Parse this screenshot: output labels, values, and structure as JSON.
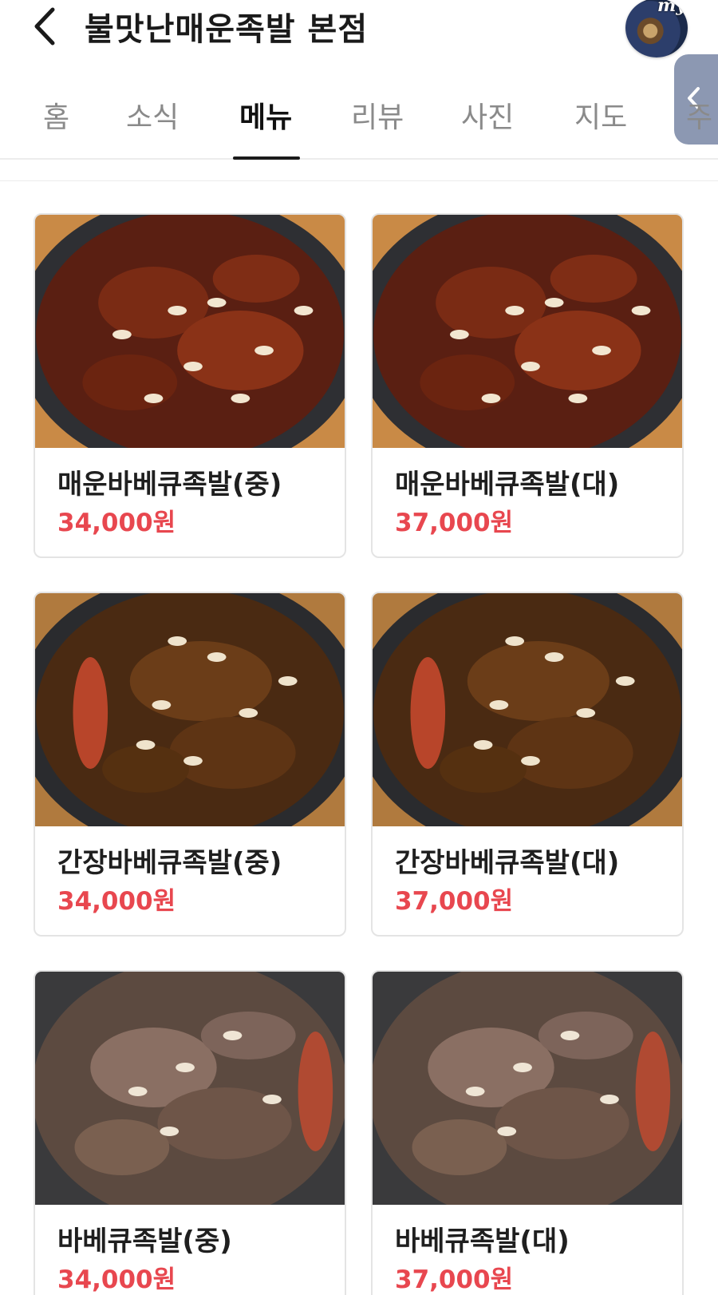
{
  "header": {
    "title": "불맛난매운족발 본점",
    "avatar_badge": "my"
  },
  "tabs": [
    {
      "label": "홈"
    },
    {
      "label": "소식"
    },
    {
      "label": "메뉴"
    },
    {
      "label": "리뷰"
    },
    {
      "label": "사진"
    },
    {
      "label": "지도"
    },
    {
      "label": "주"
    }
  ],
  "active_tab": "메뉴",
  "menu": [
    {
      "name": "매운바베큐족발(중)",
      "price": "34,000원",
      "photo": "spicy-bbq-jokbal"
    },
    {
      "name": "매운바베큐족발(대)",
      "price": "37,000원",
      "photo": "spicy-bbq-jokbal"
    },
    {
      "name": "간장바베큐족발(중)",
      "price": "34,000원",
      "photo": "soy-bbq-jokbal"
    },
    {
      "name": "간장바베큐족발(대)",
      "price": "37,000원",
      "photo": "soy-bbq-jokbal"
    },
    {
      "name": "바베큐족발(중)",
      "price": "34,000원",
      "photo": "bbq-jokbal"
    },
    {
      "name": "바베큐족발(대)",
      "price": "37,000원",
      "photo": "bbq-jokbal"
    }
  ],
  "colors": {
    "price": "#e8474f",
    "active_tab": "#111111",
    "inactive_tab": "#8a8a8a"
  }
}
